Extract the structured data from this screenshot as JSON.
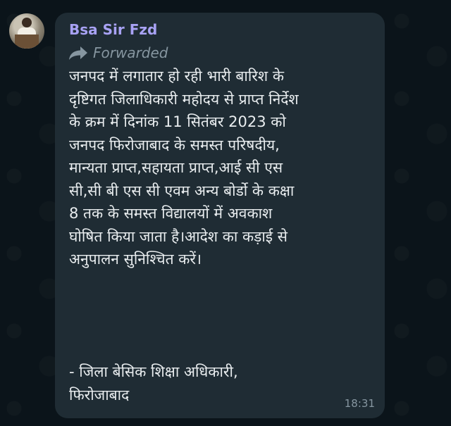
{
  "message": {
    "sender": "Bsa Sir Fzd",
    "forwarded_label": "Forwarded",
    "body_lines": [
      "जनपद में लगातार हो रही भारी बारिश के",
      "दृष्टिगत जिलाधिकारी महोदय से प्राप्त निर्देश",
      "के क्रम में दिनांक 11 सितंबर 2023 को",
      "जनपद फिरोजाबाद के समस्त परिषदीय,",
      "मान्यता प्राप्त,सहायता प्राप्त,आई सी एस",
      "सी,सी बी एस सी एवम अन्य बोर्डो के कक्षा",
      "8 तक के समस्त विद्यालयों में अवकाश",
      "घोषित किया जाता है।आदेश का कड़ाई से",
      "अनुपालन सुनिश्चित करें।"
    ],
    "signature_lines": [
      "- जिला बेसिक शिक्षा अधिकारी,",
      "फिरोजाबाद"
    ],
    "time": "18:31"
  },
  "icons": {
    "avatar": "profile-photo",
    "forward": "forward-arrow-icon"
  },
  "colors": {
    "background": "#0b141a",
    "bubble": "#1f2c34",
    "sender": "#a8a2f4",
    "text": "#e9edef",
    "meta": "#8696a0"
  }
}
